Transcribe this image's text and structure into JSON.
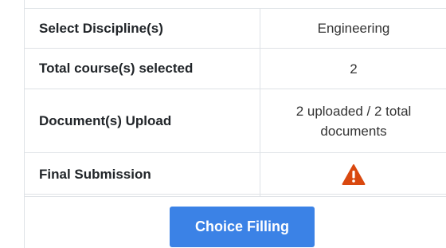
{
  "summary": {
    "rows": [
      {
        "label": "Select Discipline(s)",
        "value": "Engineering"
      },
      {
        "label": "Total course(s) selected",
        "value": "2"
      },
      {
        "label": "Document(s) Upload",
        "value": "2 uploaded / 2 total documents"
      },
      {
        "label": "Final Submission",
        "value_icon": "warning-icon",
        "value_icon_color": "#d9480f"
      }
    ]
  },
  "actions": {
    "choice_filling_label": "Choice Filling",
    "button_color": "#3b82e6"
  }
}
